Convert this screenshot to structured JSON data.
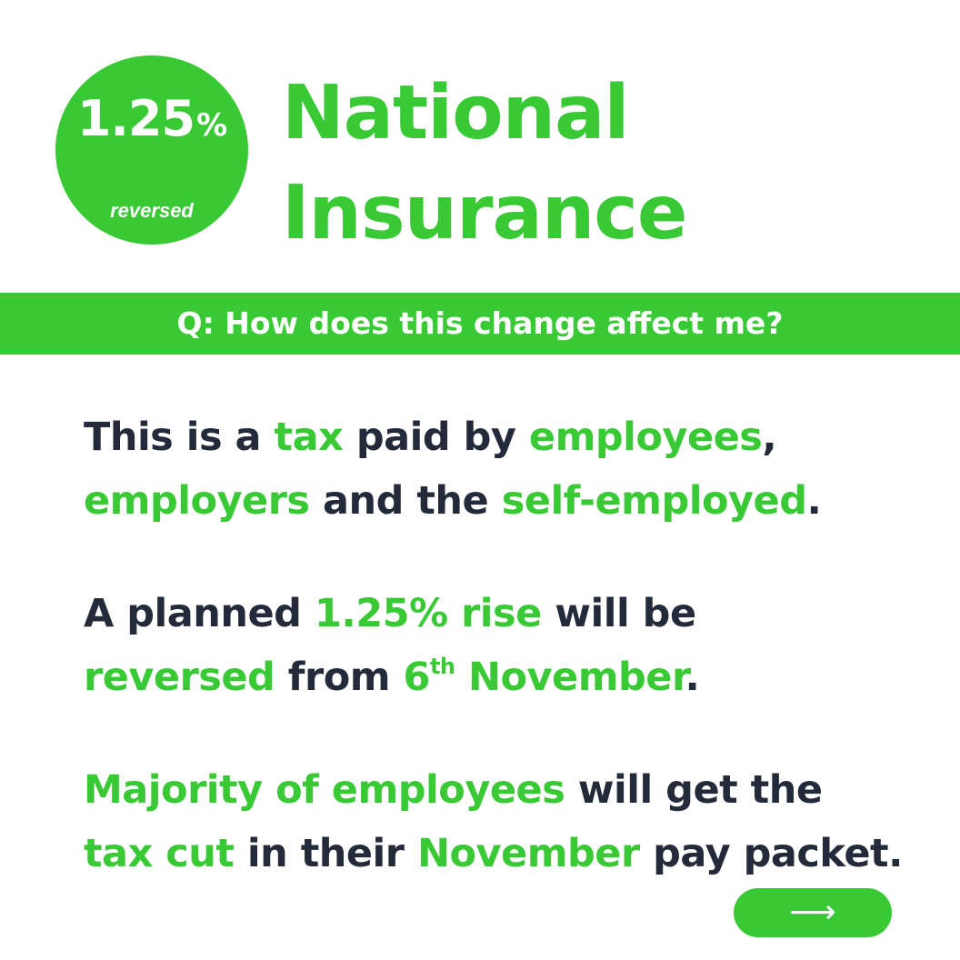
{
  "badge": {
    "value": "1.25",
    "unit": "%",
    "caption": "reversed"
  },
  "title": {
    "line1": "National",
    "line2": "Insurance"
  },
  "question": "Q: How does this change affect me?",
  "paragraphs": {
    "p1": {
      "s1": "This is a ",
      "s2": "tax",
      "s3": " paid by ",
      "s4": "employees",
      "s5": ",",
      "s6": "employers",
      "s7": " and the ",
      "s8": "self-employed",
      "s9": "."
    },
    "p2": {
      "s1": "A planned ",
      "s2": "1.25% rise",
      "s3": " will be",
      "s4": "reversed",
      "s5": " from ",
      "s6": "6",
      "s7": "th",
      "s8": " November",
      "s9": "."
    },
    "p3": {
      "s1": "Majority of employees",
      "s2": " will get the",
      "s3": "tax cut",
      "s4": " in their ",
      "s5": "November",
      "s6": " pay packet."
    }
  },
  "next_button": {
    "icon": "arrow-right-icon",
    "glyph": "⟶"
  },
  "colors": {
    "accent": "#38c934",
    "text": "#232b3a",
    "background": "#ffffff"
  }
}
